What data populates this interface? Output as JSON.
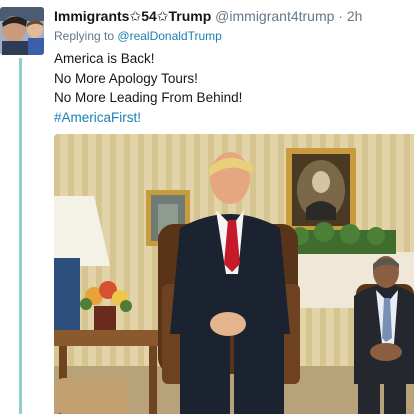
{
  "tweet": {
    "display_name": "Immigrants✩54✩Trump",
    "handle": "@immigrant4trump",
    "separator": "·",
    "time": "2h",
    "reply_prefix": "Replying to",
    "reply_to": "@realDonaldTrump",
    "lines": [
      "America is Back!",
      "No More Apology Tours!",
      "No More Leading From Behind!"
    ],
    "hashtag": "#AmericaFirst!"
  },
  "colors": {
    "link": "#1b7fb4",
    "thread_line": "#8ed1cc",
    "muted": "#657786"
  },
  "icons": {
    "avatar": "profile-photo"
  }
}
